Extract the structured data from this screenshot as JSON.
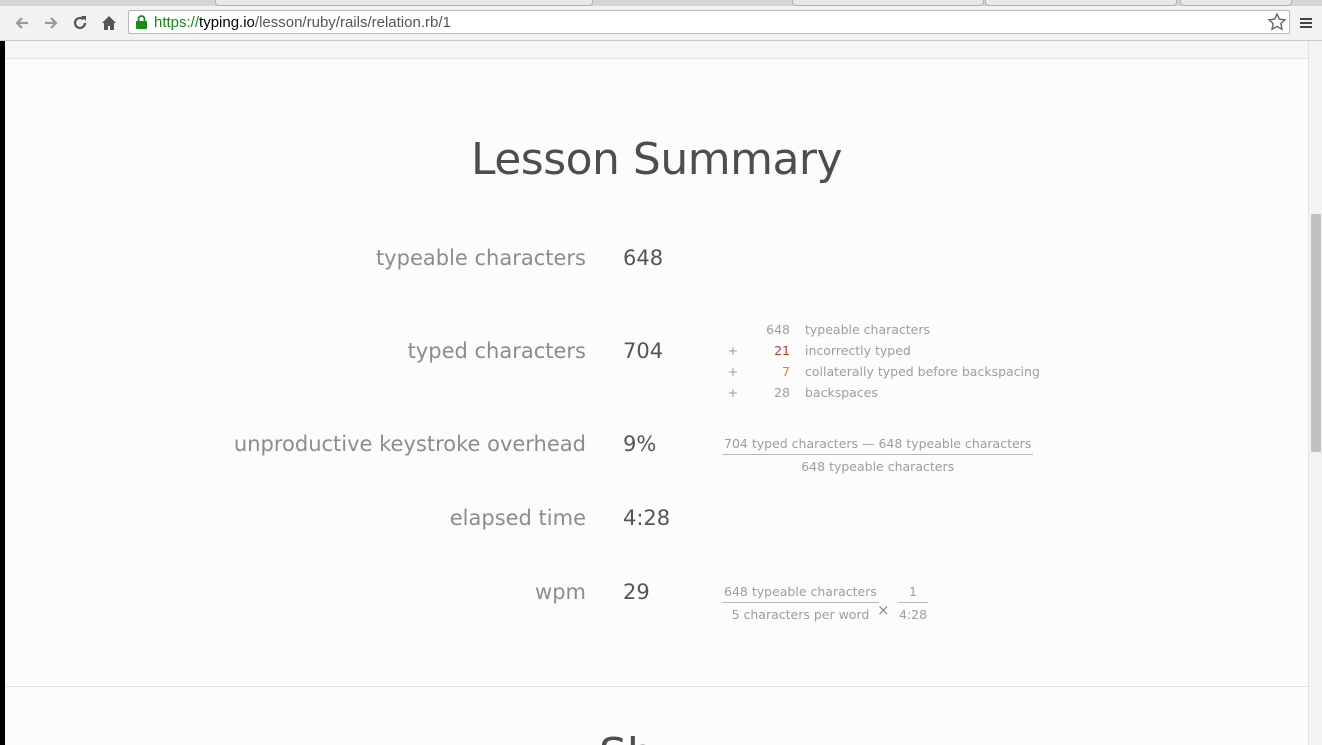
{
  "browser": {
    "url_scheme": "https://",
    "url_host": "typing.io",
    "url_path": "/lesson/ruby/rails/relation.rb/1"
  },
  "page": {
    "title": "Lesson Summary",
    "next_section_title_partial": "Sh"
  },
  "stats": {
    "typeable": {
      "label": "typeable characters",
      "value": "648"
    },
    "typed": {
      "label": "typed characters",
      "value": "704"
    },
    "overhead": {
      "label": "unproductive keystroke overhead",
      "value": "9%"
    },
    "elapsed": {
      "label": "elapsed time",
      "value": "4:28"
    },
    "wpm": {
      "label": "wpm",
      "value": "29"
    }
  },
  "typed_breakdown": [
    {
      "op": "",
      "num": "648",
      "desc": "typeable characters",
      "color": "#9d9d9d"
    },
    {
      "op": "+",
      "num": "21",
      "desc": "incorrectly typed",
      "color": "#c0392b"
    },
    {
      "op": "+",
      "num": "7",
      "desc": "collaterally typed before backspacing",
      "color": "#e08a00"
    },
    {
      "op": "+",
      "num": "28",
      "desc": "backspaces",
      "color": "#9d9d9d"
    }
  ],
  "overhead_formula": {
    "numerator": "704 typed characters — 648 typeable characters",
    "denominator": "648 typeable characters"
  },
  "wpm_formula": {
    "numerator1": "648 typeable characters",
    "denominator1": "5 characters per word",
    "operator": "×",
    "numerator2": "1",
    "denominator2": "4:28"
  }
}
